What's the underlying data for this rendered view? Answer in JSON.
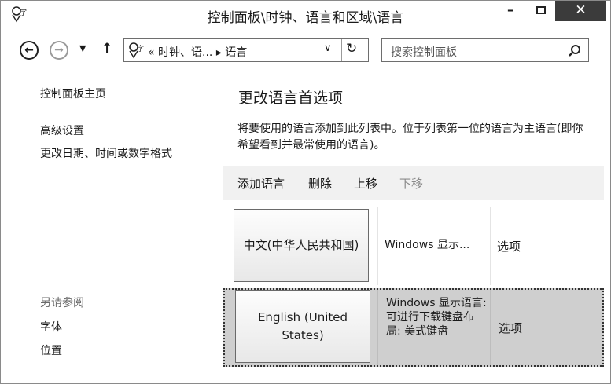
{
  "window": {
    "title": "控制面板\\时钟、语言和区域\\语言",
    "minimize": "–",
    "close": "✕"
  },
  "nav": {
    "back": "←",
    "forward": "→",
    "recent": "▼",
    "up": "↑",
    "address": "« 时钟、语... ▸ 语言",
    "dropdown": "∨",
    "refresh": "↻",
    "search_placeholder": "搜索控制面板"
  },
  "sidebar": {
    "home": "控制面板主页",
    "advanced": "高级设置",
    "change_format": "更改日期、时间或数字格式",
    "see_also": "另请参阅",
    "fonts": "字体",
    "location": "位置"
  },
  "main": {
    "title": "更改语言首选项",
    "description": "将要使用的语言添加到此列表中。位于列表第一位的语言为主语言(即你希望看到并最常使用的语言)。",
    "toolbar": {
      "add": "添加语言",
      "remove": "删除",
      "move_up": "上移",
      "move_down": "下移"
    },
    "languages": [
      {
        "name": "中文(中华人民共和国)",
        "status": "Windows 显示...",
        "options": "选项"
      },
      {
        "name": "English (United States)",
        "status": "Windows 显示语言: 可进行下载键盘布局: 美式键盘",
        "options": "选项"
      }
    ]
  },
  "icons": [
    "control-panel-icon",
    "back-arrow-icon",
    "forward-arrow-icon",
    "recent-pages-icon",
    "up-arrow-icon",
    "dropdown-icon",
    "refresh-icon",
    "search-icon"
  ]
}
